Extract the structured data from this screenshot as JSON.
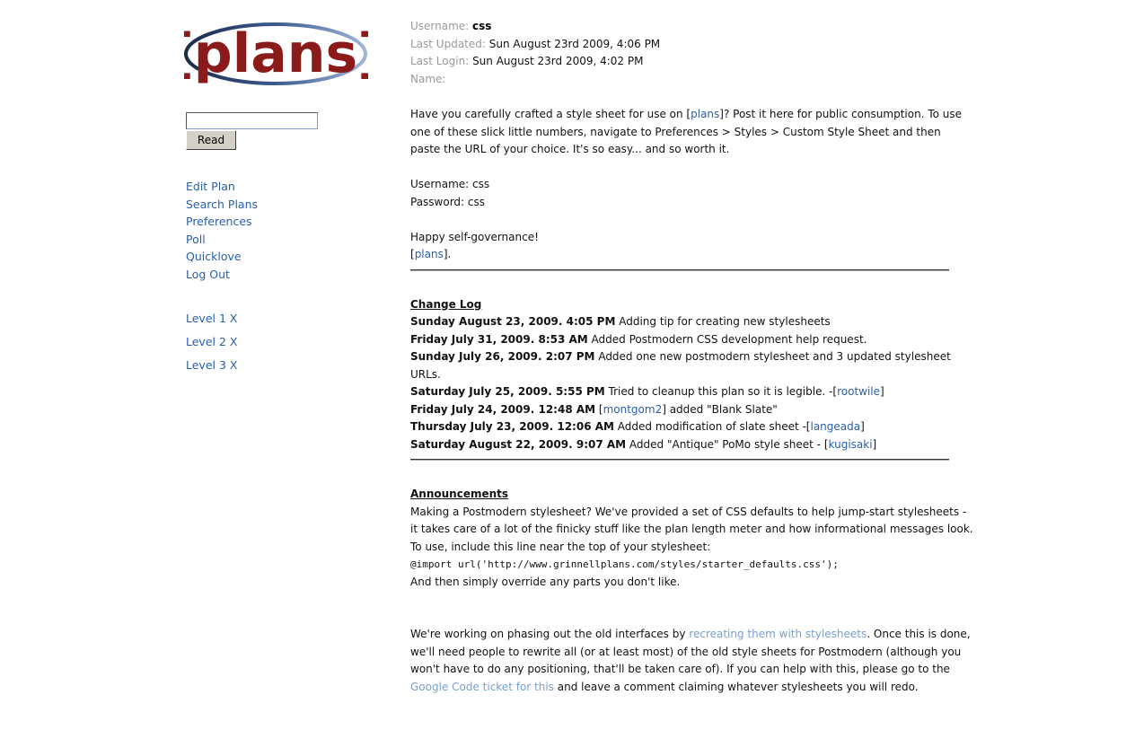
{
  "logo": {
    "text": "[plans]"
  },
  "read_form": {
    "input_value": "",
    "button_label": "Read"
  },
  "nav": {
    "items": [
      "Edit Plan",
      "Search Plans",
      "Preferences",
      "Poll",
      "Quicklove",
      "Log Out"
    ],
    "levels": [
      "Level 1 X",
      "Level 2 X",
      "Level 3 X"
    ]
  },
  "user_info": {
    "username_label": "Username:",
    "username": "css",
    "last_updated_label": "Last Updated:",
    "last_updated": "Sun August 23rd 2009, 4:06 PM",
    "last_login_label": "Last Login:",
    "last_login": "Sun August 23rd 2009, 4:02 PM",
    "name_label": "Name:"
  },
  "intro": {
    "p1_a": "Have you carefully crafted a style sheet for use on [",
    "p1_link": "plans",
    "p1_b": "]? Post it here for public consumption. To use",
    "p1_line2": "one of these slick little numbers, navigate to Preferences > Styles > Custom Style Sheet and then",
    "p1_line3": "paste the URL of your choice. It's so easy... and so worth it.",
    "cred_user": "Username: css",
    "cred_pass": "Password: css",
    "closing": "Happy self-governance!",
    "sign_a": "[",
    "sign_link": "plans",
    "sign_b": "]."
  },
  "changelog": {
    "title": "Change Log",
    "entries": [
      {
        "date": "Sunday August 23, 2009. 4:05 PM",
        "pre": " Adding tip for creating new stylesheets",
        "link": "",
        "post": ""
      },
      {
        "date": "Friday July 31, 2009. 8:53 AM",
        "pre": " Added Postmodern CSS development help request.",
        "link": "",
        "post": ""
      },
      {
        "date": "Sunday July 26, 2009. 2:07 PM",
        "pre": " Added one new postmodern stylesheet and 3 updated stylesheet",
        "line2": "URLs.",
        "link": "",
        "post": ""
      },
      {
        "date": "Saturday July 25, 2009. 5:55 PM",
        "pre": " Tried to cleanup this plan so it is legible. -[",
        "link": "rootwile",
        "post": "]"
      },
      {
        "date": "Friday July 24, 2009. 12:48 AM",
        "pre": " [",
        "link": "montgom2",
        "post": "] added \"Blank Slate\""
      },
      {
        "date": "Thursday July 23, 2009. 12:06 AM",
        "pre": " Added modification of slate sheet -[",
        "link": "langeada",
        "post": "]"
      },
      {
        "date": "Saturday August 22, 2009. 9:07 AM",
        "pre": " Added \"Antique\" PoMo style sheet - [",
        "link": "kugisaki",
        "post": "]"
      }
    ]
  },
  "announcements": {
    "title": "Announcements",
    "line1": "Making a Postmodern stylesheet? We've provided a set of CSS defaults to help jump-start stylesheets -",
    "line2": "it takes care of a lot of the finicky stuff like the plan length meter and how informational messages look.",
    "line3": "To use, include this line near the top of your stylesheet:",
    "code": "@import url('http://www.grinnellplans.com/styles/starter_defaults.css');",
    "line4": "And then simply override any parts you don't like.",
    "p2_a": "We're working on phasing out the old interfaces by ",
    "p2_link1": "recreating them with stylesheets",
    "p2_b": ". Once this is done,",
    "p2_line2": "we'll need people to rewrite all (or at least most) of the old style sheets for Postmodern (although you",
    "p2_line3": "won't have to do any positioning, that'll be taken care of). If you can help with this, please go to the",
    "p2_link2": "Google Code ticket for this",
    "p2_c": " and leave a comment claiming whatever stylesheets you will redo."
  },
  "colors": {
    "link": "#2a5ea8",
    "link_light": "#7aa0cc",
    "logo_red": "#8b1a1a",
    "label_gray": "#999999"
  }
}
